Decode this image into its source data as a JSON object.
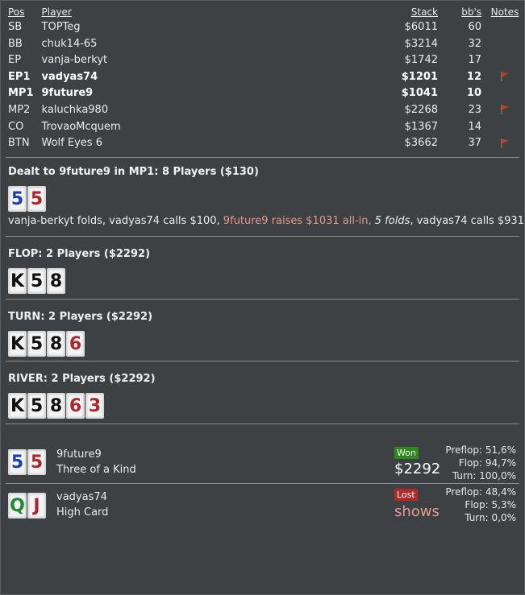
{
  "table": {
    "headers": {
      "pos": "Pos",
      "player": "Player",
      "stack": "Stack",
      "bbs": "bb's",
      "notes": "Notes"
    },
    "rows": [
      {
        "pos": "SB",
        "player": "TOPTeg",
        "stack": "$6011",
        "bbs": "60",
        "flag": false,
        "hero": false
      },
      {
        "pos": "BB",
        "player": "chuk14-65",
        "stack": "$3214",
        "bbs": "32",
        "flag": false,
        "hero": false
      },
      {
        "pos": "EP",
        "player": "vanja-berkyt",
        "stack": "$1742",
        "bbs": "17",
        "flag": false,
        "hero": false
      },
      {
        "pos": "EP1",
        "player": "vadyas74",
        "stack": "$1201",
        "bbs": "12",
        "flag": true,
        "hero": true
      },
      {
        "pos": "MP1",
        "player": "9future9",
        "stack": "$1041",
        "bbs": "10",
        "flag": false,
        "hero": true
      },
      {
        "pos": "MP2",
        "player": "kaluchka980",
        "stack": "$2268",
        "bbs": "23",
        "flag": true,
        "hero": false
      },
      {
        "pos": "CO",
        "player": "TrovaoMcquem",
        "stack": "$1367",
        "bbs": "14",
        "flag": false,
        "hero": false
      },
      {
        "pos": "BTN",
        "player": "Wolf Eyes 6",
        "stack": "$3662",
        "bbs": "37",
        "flag": true,
        "hero": false
      }
    ]
  },
  "colors": {
    "flag": "#c0392b",
    "raise": "#e39a8a",
    "won": "#2f8a1e",
    "lost": "#b02a2a"
  },
  "preflop": {
    "title": "Dealt to 9future9 in MP1: 8 Players ($130)",
    "cards": [
      {
        "rank": "5",
        "color": "blue"
      },
      {
        "rank": "5",
        "color": "red"
      }
    ],
    "actions": {
      "a1": "vanja-berkyt folds, vadyas74 calls $100, ",
      "a2": "9future9 raises $1031 all-in, ",
      "a3": "5 folds",
      "a4": ", vadyas74 calls $931"
    }
  },
  "flop": {
    "title": "FLOP: 2 Players ($2292)",
    "cards": [
      {
        "rank": "K",
        "color": "black"
      },
      {
        "rank": "5",
        "color": "black"
      },
      {
        "rank": "8",
        "color": "black"
      }
    ]
  },
  "turn": {
    "title": "TURN: 2 Players ($2292)",
    "cards": [
      {
        "rank": "K",
        "color": "black"
      },
      {
        "rank": "5",
        "color": "black"
      },
      {
        "rank": "8",
        "color": "black"
      },
      {
        "rank": "6",
        "color": "red"
      }
    ]
  },
  "river": {
    "title": "RIVER: 2 Players ($2292)",
    "cards": [
      {
        "rank": "K",
        "color": "black"
      },
      {
        "rank": "5",
        "color": "black"
      },
      {
        "rank": "8",
        "color": "black"
      },
      {
        "rank": "6",
        "color": "red"
      },
      {
        "rank": "3",
        "color": "red"
      }
    ]
  },
  "results": [
    {
      "player": "9future9",
      "hand": "Three of a Kind",
      "badge": "Won",
      "amount": "$2292",
      "cards": [
        {
          "rank": "5",
          "color": "blue"
        },
        {
          "rank": "5",
          "color": "red"
        }
      ],
      "equity": {
        "preflop_label": "Preflop:",
        "preflop": "51,6%",
        "flop_label": "Flop:",
        "flop": "94,7%",
        "turn_label": "Turn:",
        "turn": "100,0%"
      }
    },
    {
      "player": "vadyas74",
      "hand": "High Card",
      "badge": "Lost",
      "amount": "shows",
      "cards": [
        {
          "rank": "Q",
          "color": "green"
        },
        {
          "rank": "J",
          "color": "red"
        }
      ],
      "equity": {
        "preflop_label": "Preflop:",
        "preflop": "48,4%",
        "flop_label": "Flop:",
        "flop": "5,3%",
        "turn_label": "Turn:",
        "turn": "0,0%"
      }
    }
  ]
}
